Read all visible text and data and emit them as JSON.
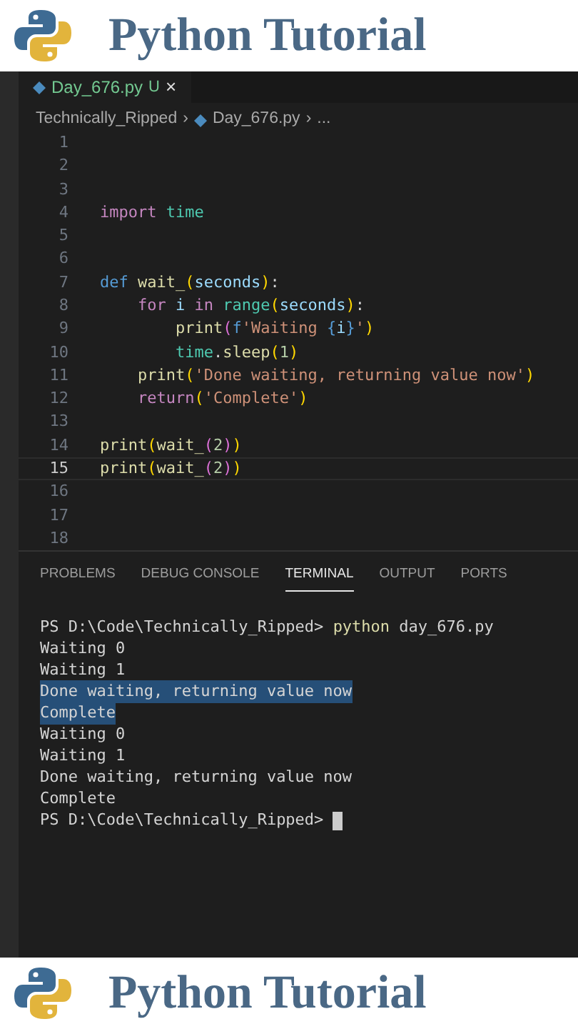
{
  "top_banner": {
    "title": "Python Tutorial"
  },
  "editor": {
    "tab": {
      "label": "Day_676.py",
      "badge": "U",
      "close": "×",
      "selected": true
    },
    "breadcrumb": [
      {
        "label": "Technically_Ripped",
        "kind": "folder",
        "separator": "›"
      },
      {
        "label": "Day_676.py",
        "kind": "file",
        "separator": "›"
      },
      {
        "label": "...",
        "kind": "more"
      }
    ],
    "lines": [
      {
        "number": "1",
        "current": false
      },
      {
        "number": "2",
        "current": false
      },
      {
        "number": "3",
        "current": false
      },
      {
        "number": "4",
        "current": false,
        "tokens": [
          {
            "text": "import ",
            "kind": "keyword"
          },
          {
            "text": "time",
            "kind": "module"
          }
        ]
      },
      {
        "number": "5",
        "current": false
      },
      {
        "number": "6",
        "current": false
      },
      {
        "number": "7",
        "current": false,
        "tokens": [
          {
            "text": "def ",
            "kind": "storage"
          },
          {
            "text": "wait_",
            "kind": "function"
          },
          {
            "text": "(",
            "kind": "bracket1"
          },
          {
            "text": "seconds",
            "kind": "variable"
          },
          {
            "text": ")",
            "kind": "bracket1"
          },
          {
            "text": ":",
            "kind": "plain"
          }
        ]
      },
      {
        "number": "8",
        "current": false,
        "tokens": [
          {
            "text": "    for ",
            "kind": "keyword"
          },
          {
            "text": "i ",
            "kind": "variable"
          },
          {
            "text": "in ",
            "kind": "keyword"
          },
          {
            "text": "range",
            "kind": "module"
          },
          {
            "text": "(",
            "kind": "bracket1"
          },
          {
            "text": "seconds",
            "kind": "variable"
          },
          {
            "text": ")",
            "kind": "bracket1"
          },
          {
            "text": ":",
            "kind": "plain"
          }
        ]
      },
      {
        "number": "9",
        "current": false,
        "tokens": [
          {
            "text": "        print",
            "kind": "function"
          },
          {
            "text": "(",
            "kind": "bracket2"
          },
          {
            "text": "f",
            "kind": "storage"
          },
          {
            "text": "'Waiting ",
            "kind": "string"
          },
          {
            "text": "{",
            "kind": "storage"
          },
          {
            "text": "i",
            "kind": "variable"
          },
          {
            "text": "}",
            "kind": "storage"
          },
          {
            "text": "'",
            "kind": "string"
          },
          {
            "text": ")",
            "kind": "bracket1"
          }
        ]
      },
      {
        "number": "10",
        "current": false,
        "tokens": [
          {
            "text": "        time",
            "kind": "module"
          },
          {
            "text": ".",
            "kind": "plain"
          },
          {
            "text": "sleep",
            "kind": "function"
          },
          {
            "text": "(",
            "kind": "bracket1"
          },
          {
            "text": "1",
            "kind": "number"
          },
          {
            "text": ")",
            "kind": "bracket1"
          }
        ]
      },
      {
        "number": "11",
        "current": false,
        "tokens": [
          {
            "text": "    print",
            "kind": "function"
          },
          {
            "text": "(",
            "kind": "bracket1"
          },
          {
            "text": "'Done waiting, returning value now'",
            "kind": "string"
          },
          {
            "text": ")",
            "kind": "bracket1"
          }
        ]
      },
      {
        "number": "12",
        "current": false,
        "tokens": [
          {
            "text": "    return",
            "kind": "keyword"
          },
          {
            "text": "(",
            "kind": "bracket1"
          },
          {
            "text": "'Complete'",
            "kind": "string"
          },
          {
            "text": ")",
            "kind": "bracket1"
          }
        ]
      },
      {
        "number": "13",
        "current": false
      },
      {
        "number": "14",
        "current": false,
        "tokens": [
          {
            "text": "print",
            "kind": "function"
          },
          {
            "text": "(",
            "kind": "bracket1"
          },
          {
            "text": "wait_",
            "kind": "function"
          },
          {
            "text": "(",
            "kind": "bracket2"
          },
          {
            "text": "2",
            "kind": "number"
          },
          {
            "text": ")",
            "kind": "bracket2"
          },
          {
            "text": ")",
            "kind": "bracket1"
          }
        ]
      },
      {
        "number": "15",
        "current": true,
        "tokens": [
          {
            "text": "print",
            "kind": "function"
          },
          {
            "text": "(",
            "kind": "bracket1"
          },
          {
            "text": "wait_",
            "kind": "function"
          },
          {
            "text": "(",
            "kind": "bracket2"
          },
          {
            "text": "2",
            "kind": "number"
          },
          {
            "text": ")",
            "kind": "bracket2"
          },
          {
            "text": ")",
            "kind": "bracket1"
          }
        ]
      },
      {
        "number": "16",
        "current": false
      },
      {
        "number": "17",
        "current": false
      },
      {
        "number": "18",
        "current": false
      }
    ]
  },
  "panel": {
    "tabs": [
      {
        "label": "PROBLEMS",
        "selected": false
      },
      {
        "label": "DEBUG CONSOLE",
        "selected": false
      },
      {
        "label": "TERMINAL",
        "selected": true
      },
      {
        "label": "OUTPUT",
        "selected": false
      },
      {
        "label": "PORTS",
        "selected": false
      }
    ],
    "terminal_lines": [
      {
        "selected": false,
        "cursor": false,
        "tokens": [
          {
            "text": "PS D:\\Code\\Technically_Ripped> ",
            "kind": "plain"
          },
          {
            "text": "python",
            "kind": "function"
          },
          {
            "text": " day_676.py",
            "kind": "plain"
          }
        ]
      },
      {
        "selected": false,
        "cursor": false,
        "tokens": [
          {
            "text": "Waiting 0",
            "kind": "plain"
          }
        ]
      },
      {
        "selected": false,
        "cursor": false,
        "tokens": [
          {
            "text": "Waiting 1",
            "kind": "plain"
          }
        ]
      },
      {
        "selected": true,
        "cursor": false,
        "tokens": [
          {
            "text": "Done waiting, returning value now",
            "kind": "plain"
          }
        ]
      },
      {
        "selected": true,
        "cursor": false,
        "tokens": [
          {
            "text": "Complete",
            "kind": "plain"
          }
        ]
      },
      {
        "selected": false,
        "cursor": false,
        "tokens": [
          {
            "text": "Waiting 0",
            "kind": "plain"
          }
        ]
      },
      {
        "selected": false,
        "cursor": false,
        "tokens": [
          {
            "text": "Waiting 1",
            "kind": "plain"
          }
        ]
      },
      {
        "selected": false,
        "cursor": false,
        "tokens": [
          {
            "text": "Done waiting, returning value now",
            "kind": "plain"
          }
        ]
      },
      {
        "selected": false,
        "cursor": false,
        "tokens": [
          {
            "text": "Complete",
            "kind": "plain"
          }
        ]
      },
      {
        "selected": false,
        "cursor": true,
        "tokens": [
          {
            "text": "PS D:\\Code\\Technically_Ripped> ",
            "kind": "plain"
          }
        ]
      }
    ]
  },
  "bottom_banner": {
    "title": "Python Tutorial"
  }
}
